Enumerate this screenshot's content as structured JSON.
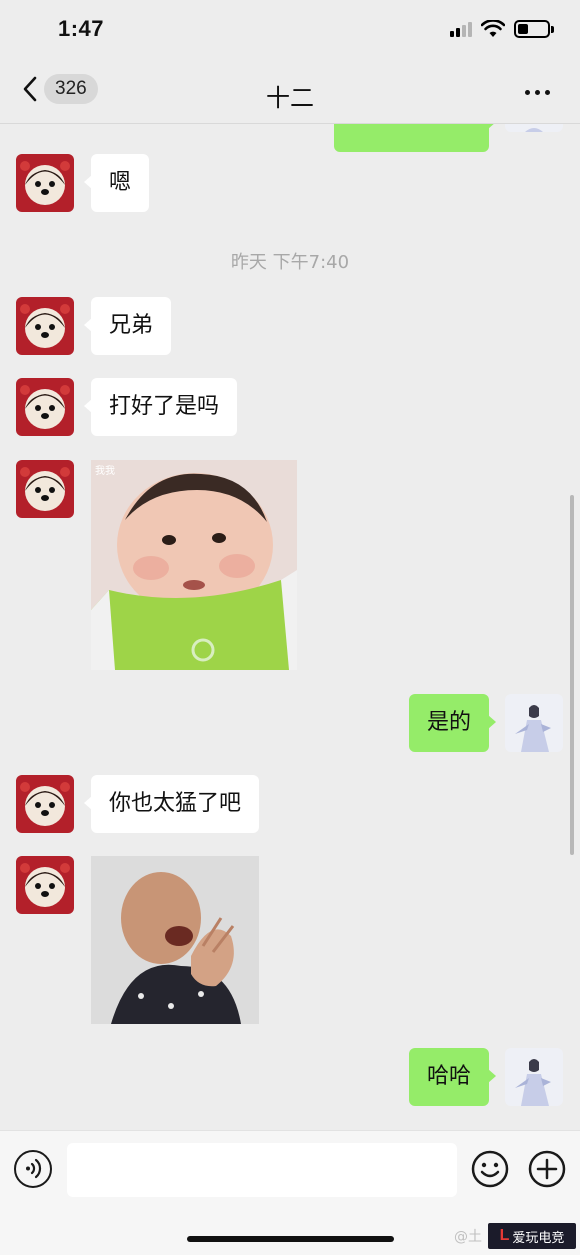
{
  "status_bar": {
    "time": "1:47"
  },
  "nav": {
    "unread_count": "326",
    "title": "十二"
  },
  "messages": [
    {
      "from": "contact",
      "type": "text",
      "text": "嗯"
    },
    {
      "type": "timestamp",
      "text": "昨天 下午7:40"
    },
    {
      "from": "contact",
      "type": "text",
      "text": "兄弟"
    },
    {
      "from": "contact",
      "type": "text",
      "text": "打好了是吗"
    },
    {
      "from": "contact",
      "type": "sticker",
      "caption": "我我"
    },
    {
      "from": "me",
      "type": "text",
      "text": "是的"
    },
    {
      "from": "contact",
      "type": "text",
      "text": "你也太猛了吧"
    },
    {
      "from": "contact",
      "type": "sticker",
      "caption": ""
    },
    {
      "from": "me",
      "type": "text",
      "text": "哈哈"
    }
  ],
  "input": {
    "placeholder": "",
    "value": ""
  },
  "watermark": {
    "faint": "@土",
    "logo_mark": "L",
    "logo_text": "爱玩电竞"
  },
  "colors": {
    "background": "#ededed",
    "my_bubble": "#95ec69",
    "their_bubble": "#ffffff",
    "timestamp": "#a8a8a8"
  },
  "icons": [
    "chevron-left-icon",
    "more-dots-icon",
    "voice-icon",
    "emoji-icon",
    "plus-icon"
  ]
}
